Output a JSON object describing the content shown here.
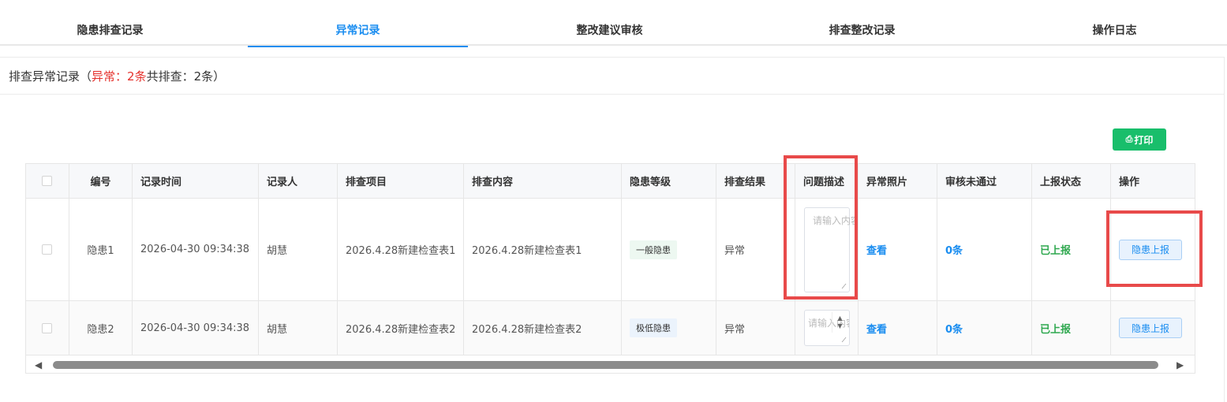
{
  "tabs": [
    {
      "label": "隐患排查记录"
    },
    {
      "label": "异常记录"
    },
    {
      "label": "整改建议审核"
    },
    {
      "label": "排查整改记录"
    },
    {
      "label": "操作日志"
    }
  ],
  "panel": {
    "title_prefix": "排查异常记录（",
    "abnormal_label": "异常：",
    "abnormal_count": "2条",
    "total_label": " 共排查：",
    "total_count": "2条）"
  },
  "print_button": {
    "icon": "printer-icon",
    "label": "打印"
  },
  "table": {
    "columns": [
      "编号",
      "记录时间",
      "记录人",
      "排查项目",
      "排查内容",
      "隐患等级",
      "排查结果",
      "问题描述",
      "异常照片",
      "审核未通过",
      "上报状态",
      "操作"
    ],
    "rows": [
      {
        "id": "隐患1",
        "time": "2026-04-30 09:34:38",
        "recorder": "胡慧",
        "project": "2026.4.28新建检查表1",
        "content": "2026.4.28新建检查表1",
        "level": "一般隐患",
        "result": "异常",
        "desc_placeholder": "请输入内容",
        "photo": "查看",
        "rejected": "0条",
        "status": "已上报",
        "action": "隐患上报"
      },
      {
        "id": "隐患2",
        "time": "2026-04-30 09:34:38",
        "recorder": "胡慧",
        "project": "2026.4.28新建检查表2",
        "content": "2026.4.28新建检查表2",
        "level": "极低隐患",
        "result": "异常",
        "desc_placeholder": "请输入内容",
        "photo": "查看",
        "rejected": "0条",
        "status": "已上报",
        "action": "隐患上报"
      }
    ]
  },
  "colors": {
    "accent": "#1a8df0",
    "print_green": "#19be6b",
    "warning_red": "#e5322d",
    "status_green": "#2fa84f",
    "highlight_red": "#e84a4a"
  }
}
